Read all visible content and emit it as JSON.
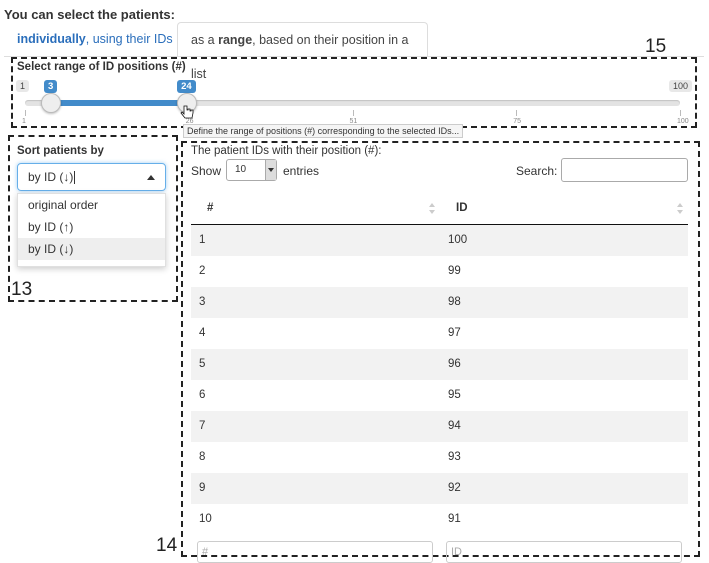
{
  "header": {
    "title": "You can select the patients:"
  },
  "tabs": [
    {
      "bold": "individually",
      "rest": ", using their IDs"
    },
    {
      "pre": "as a ",
      "bold": "range",
      "rest": ", based on their position in a list"
    }
  ],
  "annotations": {
    "a15": "15",
    "a13": "13",
    "a14": "14"
  },
  "slider": {
    "label": "Select range of ID positions (#)",
    "min_label": "1",
    "max_label": "100",
    "from": 3,
    "to": 24,
    "min": 1,
    "max": 100,
    "ticks": [
      "1",
      "26",
      "51",
      "75",
      "100"
    ],
    "tooltip": "Define the range of positions (#) corresponding to the selected IDs..."
  },
  "sort": {
    "label": "Sort patients by",
    "selected": "by ID (↓)",
    "options": [
      "original order",
      "by ID (↑)",
      "by ID (↓)"
    ]
  },
  "table": {
    "label": "The patient IDs with their position (#):",
    "show_label": "Show",
    "entries_value": "10",
    "entries_label": "entries",
    "search_label": "Search:",
    "columns": [
      "#",
      "ID"
    ],
    "rows": [
      [
        "1",
        "100"
      ],
      [
        "2",
        "99"
      ],
      [
        "3",
        "98"
      ],
      [
        "4",
        "97"
      ],
      [
        "5",
        "96"
      ],
      [
        "6",
        "95"
      ],
      [
        "7",
        "94"
      ],
      [
        "8",
        "93"
      ],
      [
        "9",
        "92"
      ],
      [
        "10",
        "91"
      ]
    ],
    "footer_placeholders": [
      "#",
      "ID"
    ]
  },
  "colors": {
    "accent": "#428bca",
    "link": "#2a6ebb"
  }
}
